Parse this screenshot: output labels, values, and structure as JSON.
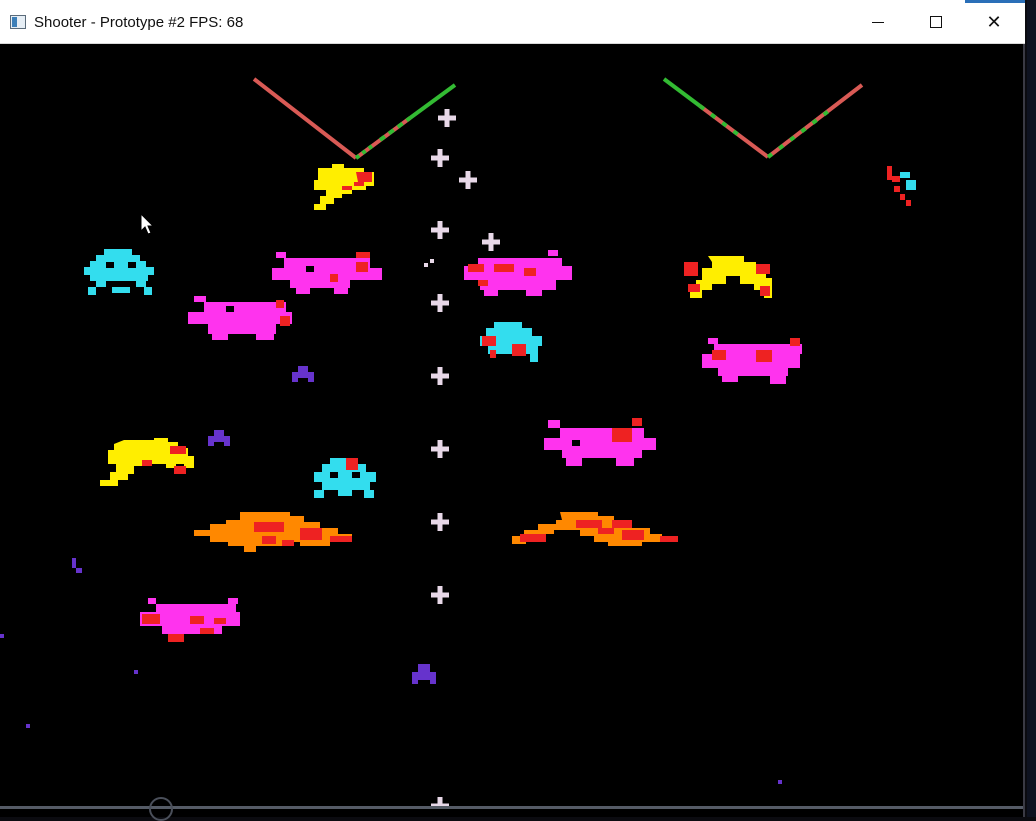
{
  "window": {
    "title": "Shooter - Prototype #2 FPS: 68",
    "minimize_label": "",
    "maximize_label": "",
    "close_label": "✕"
  },
  "icons": {
    "app": "app-window-icon",
    "minimize": "minimize-icon",
    "maximize": "maximize-icon",
    "close": "close-icon",
    "cursor": "mouse-pointer-icon"
  },
  "colors": {
    "background": "#000000",
    "yellow_alien": "#ffee00",
    "magenta_alien": "#ff33ee",
    "cyan_alien": "#33ddee",
    "orange_saucer": "#ff8800",
    "damage_red": "#ee1111",
    "purple_ship": "#6633cc",
    "bullet": "#e8d8e8",
    "laser_red": "#dd5555",
    "laser_green": "#33bb33"
  },
  "game": {
    "player_ship": "purple-chevron-ship",
    "enemies": [
      {
        "type": "yellow-blob"
      },
      {
        "type": "cyan-squid"
      },
      {
        "type": "magenta-crab"
      },
      {
        "type": "magenta-crab"
      },
      {
        "type": "magenta-crab"
      },
      {
        "type": "yellow-blob"
      },
      {
        "type": "cyan-squid"
      },
      {
        "type": "magenta-crab"
      },
      {
        "type": "magenta-crab"
      },
      {
        "type": "yellow-blob"
      },
      {
        "type": "cyan-squid"
      },
      {
        "type": "orange-saucer"
      },
      {
        "type": "orange-saucer"
      },
      {
        "type": "magenta-crab"
      }
    ]
  }
}
